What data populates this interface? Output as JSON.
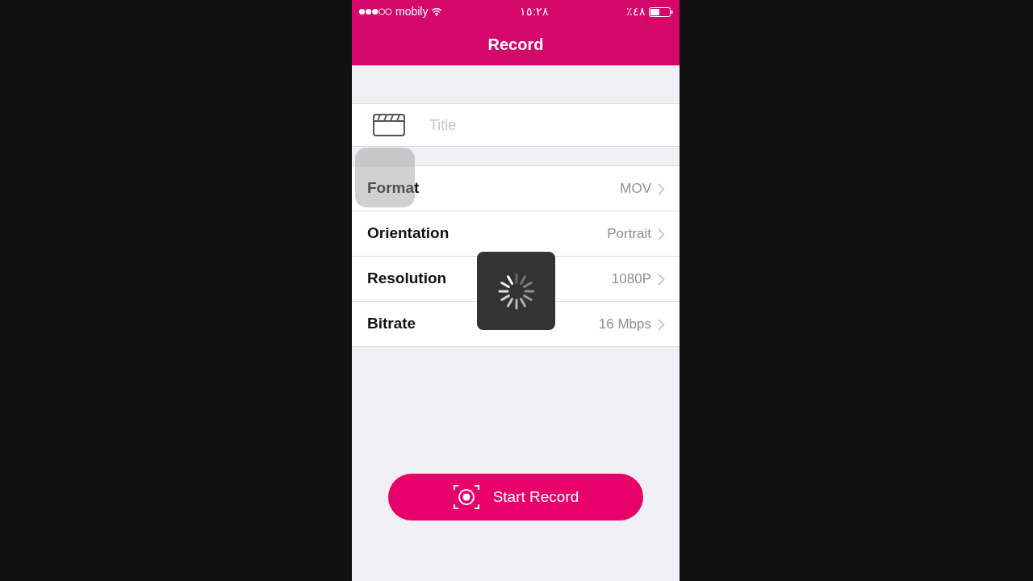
{
  "status_bar": {
    "carrier": "mobily",
    "time": "١٥:٢٨",
    "battery": "٪٤٨"
  },
  "nav_bar": {
    "title": "Record"
  },
  "title_field": {
    "placeholder": "Title"
  },
  "settings": [
    {
      "label": "Format",
      "value": "MOV"
    },
    {
      "label": "Orientation",
      "value": "Portrait"
    },
    {
      "label": "Resolution",
      "value": "1080P"
    },
    {
      "label": "Bitrate",
      "value": "16 Mbps"
    }
  ],
  "loading": true,
  "start_button": {
    "label": "Start Record"
  }
}
